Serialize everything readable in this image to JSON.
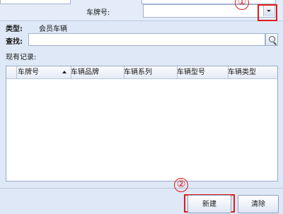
{
  "top": {
    "plate_label": "车牌号:"
  },
  "info": {
    "type_label": "类型:",
    "type_value": "会员车辆"
  },
  "search": {
    "label": "查找:",
    "value": ""
  },
  "records": {
    "label": "现有记录:"
  },
  "grid": {
    "columns": [
      "车牌号",
      "车辆品牌",
      "车辆系列",
      "车辆型号",
      "车辆类型"
    ]
  },
  "buttons": {
    "new_label": "新建",
    "clear_label": "清除"
  },
  "annotations": {
    "marker_1": "①",
    "marker_2": "②"
  },
  "colors": {
    "annotation": "#e21b1b",
    "background": "#dfe8f6"
  }
}
